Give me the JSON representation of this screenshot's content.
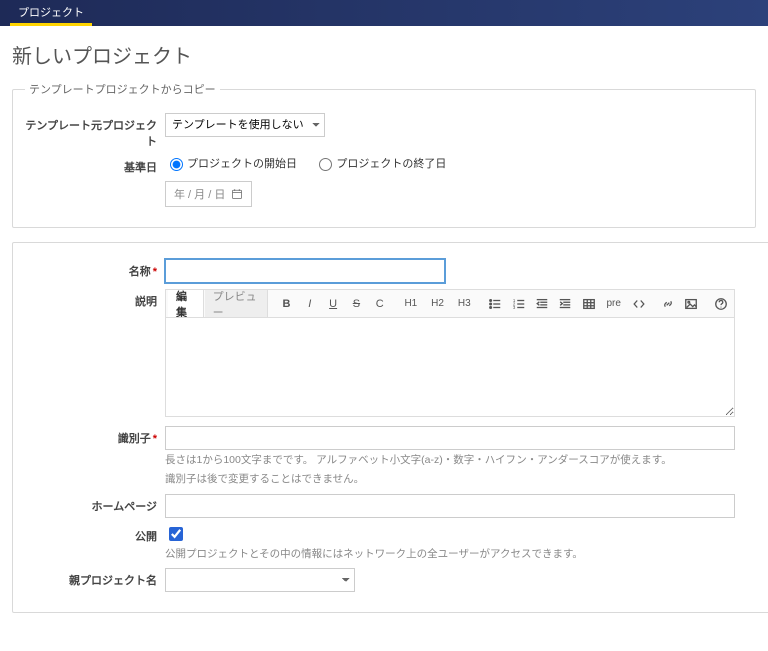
{
  "nav": {
    "project_tab": "プロジェクト"
  },
  "page": {
    "title": "新しいプロジェクト"
  },
  "template_box": {
    "legend": "テンプレートプロジェクトからコピー",
    "source_label": "テンプレート元プロジェクト",
    "source_value": "テンプレートを使用しない",
    "basis_label": "基準日",
    "radio_start": "プロジェクトの開始日",
    "radio_end": "プロジェクトの終了日",
    "date_placeholder": "年 / 月 / 日"
  },
  "fields": {
    "name_label": "名称",
    "desc_label": "説明",
    "ident_label": "識別子",
    "ident_hint1": "長さは1から100文字までです。 アルファベット小文字(a-z)・数字・ハイフン・アンダースコアが使えます。",
    "ident_hint2": "識別子は後で変更することはできません。",
    "homepage_label": "ホームページ",
    "public_label": "公開",
    "public_hint": "公開プロジェクトとその中の情報にはネットワーク上の全ユーザーがアクセスできます。",
    "parent_label": "親プロジェクト名"
  },
  "editor": {
    "tab_edit": "編集",
    "tab_preview": "プレビュー",
    "h1": "H1",
    "h2": "H2",
    "h3": "H3",
    "pre": "pre"
  }
}
